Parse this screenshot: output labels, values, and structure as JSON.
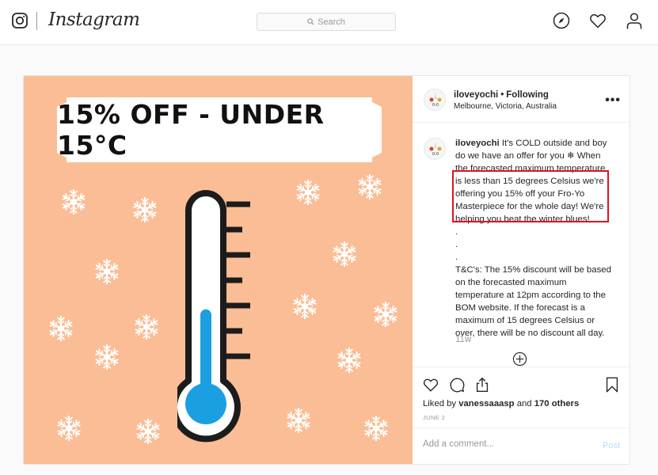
{
  "nav": {
    "logo_icon": "instagram-glyph-icon",
    "wordmark": "Instagram",
    "search": {
      "placeholder": "Search",
      "value": ""
    },
    "icons": [
      "explore-compass-icon",
      "activity-heart-icon",
      "profile-person-icon"
    ]
  },
  "post": {
    "image": {
      "banner_text": "15% OFF - UNDER 15°C",
      "background_color": "#fbbd95",
      "mercury_color": "#1a9fe0",
      "thermometer_fill_fraction": 0.45
    },
    "header": {
      "username": "iloveyochi",
      "separator": "•",
      "follow_status": "Following",
      "location": "Melbourne, Victoria, Australia",
      "more_label": "•••"
    },
    "caption": {
      "username": "iloveyochi",
      "intro": "It's COLD outside and boy do we have an offer for you ❄ When the forecasted maximum temperature",
      "highlighted": "is less than 15 degrees Celsius we're offering you 15% off your Fro-Yo Masterpiece for the whole day! We're helping you beat the winter blues!",
      "dots": [
        ".",
        ".",
        "."
      ],
      "terms": "T&C's: The 15% discount will be based on the forecasted maximum temperature at 12pm according to the BOM website. If the forecast is a maximum of 15 degrees Celsius or over, there will be no discount all day.",
      "highlight_color": "#e0141e"
    },
    "time_ago": "11w",
    "likes": {
      "prefix": "Liked by",
      "user": "vanessaaasp",
      "middle": "and",
      "others": "170 others"
    },
    "date": "JUNE 2",
    "comment": {
      "placeholder": "Add a comment...",
      "value": "",
      "post_label": "Post"
    }
  }
}
